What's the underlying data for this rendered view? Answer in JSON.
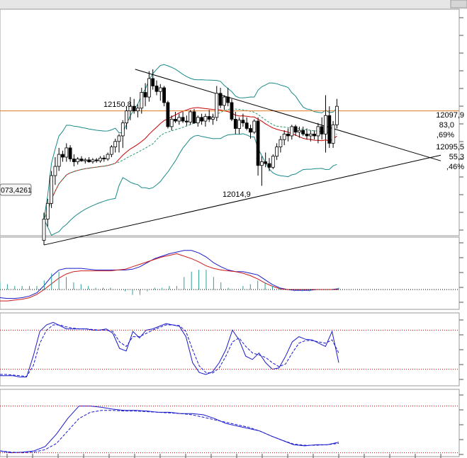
{
  "colors": {
    "background": "#ffffff",
    "frame": "#9a9a9a",
    "bollinger": "#1a8a8a",
    "ma_red": "#cc0000",
    "ma_dashed": "#2a9a6a",
    "horizontal_level": "#e07820",
    "osc_blue": "#1a1acc",
    "osc_red": "#cc1a1a",
    "histogram": "#2aa09a",
    "dotted_ref": "#cc0000"
  },
  "labels": {
    "high_label": "12150,8",
    "low_label": "12014,9",
    "left_price_box": "073,4261",
    "right_1": "12097,9",
    "right_2": "83,0",
    "right_3": ",69%",
    "right_4": "12095,5",
    "right_5": "55,3",
    "right_6": ",46%"
  },
  "chart_data": [
    {
      "type": "candlestick",
      "panel": "price",
      "title": "",
      "xlabel": "",
      "ylabel": "",
      "ylim": [
        11960,
        12205
      ],
      "horizontal_level": 12095,
      "annotations": [
        {
          "text": "12150,8",
          "kind": "swing-high"
        },
        {
          "text": "12014,9",
          "kind": "swing-low"
        },
        {
          "text": "073,4261",
          "kind": "left-price-box"
        },
        {
          "text": "12097,9"
        },
        {
          "text": "83,0"
        },
        {
          "text": ",69%"
        },
        {
          "text": "12095,5"
        },
        {
          "text": "55,3"
        },
        {
          "text": ",46%"
        }
      ],
      "candles": [
        [
          11955,
          11985,
          11950,
          11978
        ],
        [
          11978,
          12000,
          11970,
          11995
        ],
        [
          11995,
          12030,
          11990,
          12025
        ],
        [
          12025,
          12045,
          12015,
          12035
        ],
        [
          12035,
          12055,
          12030,
          12048
        ],
        [
          12048,
          12052,
          12040,
          12045
        ],
        [
          12045,
          12060,
          12040,
          12055
        ],
        [
          12055,
          12058,
          12040,
          12043
        ],
        [
          12043,
          12048,
          12035,
          12040
        ],
        [
          12040,
          12045,
          12037,
          12043
        ],
        [
          12043,
          12046,
          12040,
          12041
        ],
        [
          12041,
          12044,
          12038,
          12042
        ],
        [
          12042,
          12045,
          12039,
          12040
        ],
        [
          12040,
          12044,
          12038,
          12042
        ],
        [
          12042,
          12044,
          12039,
          12041
        ],
        [
          12041,
          12046,
          12039,
          12044
        ],
        [
          12044,
          12047,
          12040,
          12043
        ],
        [
          12043,
          12050,
          12041,
          12048
        ],
        [
          12048,
          12058,
          12045,
          12056
        ],
        [
          12056,
          12065,
          12050,
          12062
        ],
        [
          12062,
          12070,
          12050,
          12068
        ],
        [
          12068,
          12085,
          12055,
          12082
        ],
        [
          12082,
          12100,
          12075,
          12095
        ],
        [
          12095,
          12110,
          12085,
          12100
        ],
        [
          12100,
          12108,
          12092,
          12095
        ],
        [
          12095,
          12102,
          12088,
          12098
        ],
        [
          12098,
          12120,
          12092,
          12115
        ],
        [
          12115,
          12125,
          12100,
          12110
        ],
        [
          12110,
          12138,
          12105,
          12130
        ],
        [
          12130,
          12140,
          12118,
          12122
        ],
        [
          12122,
          12128,
          12112,
          12116
        ],
        [
          12116,
          12124,
          12106,
          12120
        ],
        [
          12120,
          12122,
          12100,
          12104
        ],
        [
          12104,
          12106,
          12076,
          12078
        ],
        [
          12078,
          12090,
          12074,
          12086
        ],
        [
          12086,
          12094,
          12082,
          12084
        ],
        [
          12084,
          12092,
          12080,
          12088
        ],
        [
          12088,
          12094,
          12082,
          12084
        ],
        [
          12084,
          12090,
          12079,
          12083
        ],
        [
          12083,
          12096,
          12080,
          12094
        ],
        [
          12094,
          12097,
          12081,
          12082
        ],
        [
          12082,
          12090,
          12078,
          12088
        ],
        [
          12088,
          12092,
          12080,
          12084
        ],
        [
          12084,
          12092,
          12078,
          12089
        ],
        [
          12089,
          12096,
          12083,
          12086
        ],
        [
          12086,
          12092,
          12080,
          12088
        ],
        [
          12088,
          12122,
          12084,
          12114
        ],
        [
          12114,
          12120,
          12098,
          12101
        ],
        [
          12101,
          12112,
          12096,
          12110
        ],
        [
          12110,
          12120,
          12100,
          12104
        ],
        [
          12104,
          12108,
          12084,
          12086
        ],
        [
          12086,
          12094,
          12070,
          12076
        ],
        [
          12076,
          12088,
          12070,
          12085
        ],
        [
          12085,
          12092,
          12078,
          12082
        ],
        [
          12082,
          12088,
          12074,
          12076
        ],
        [
          12076,
          12080,
          12065,
          12072
        ],
        [
          12072,
          12086,
          12070,
          12084
        ],
        [
          12084,
          12088,
          12025,
          12036
        ],
        [
          12036,
          12046,
          12014,
          12040
        ],
        [
          12040,
          12050,
          12034,
          12038
        ],
        [
          12038,
          12044,
          12030,
          12034
        ],
        [
          12034,
          12048,
          12032,
          12046
        ],
        [
          12046,
          12060,
          12042,
          12056
        ],
        [
          12056,
          12068,
          12050,
          12064
        ],
        [
          12064,
          12074,
          12058,
          12070
        ],
        [
          12070,
          12076,
          12062,
          12068
        ],
        [
          12068,
          12080,
          12064,
          12078
        ],
        [
          12078,
          12080,
          12068,
          12072
        ],
        [
          12072,
          12078,
          12066,
          12074
        ],
        [
          12074,
          12078,
          12068,
          12070
        ],
        [
          12070,
          12076,
          12064,
          12068
        ],
        [
          12068,
          12074,
          12062,
          12070
        ],
        [
          12070,
          12074,
          12064,
          12068
        ],
        [
          12068,
          12082,
          12060,
          12078
        ],
        [
          12078,
          12088,
          12064,
          12070
        ],
        [
          12070,
          12112,
          12050,
          12090
        ],
        [
          12090,
          12100,
          12055,
          12060
        ],
        [
          12060,
          12084,
          12055,
          12080
        ],
        [
          12080,
          12108,
          12076,
          12100
        ]
      ]
    },
    {
      "type": "line",
      "panel": "macd",
      "title": "",
      "series": [
        {
          "values": [
            -10,
            -11,
            -11,
            -10,
            -8,
            -4,
            5,
            16,
            24,
            26,
            26,
            26,
            25,
            24,
            24,
            24,
            24,
            24,
            25,
            28,
            33,
            38,
            41,
            44,
            46,
            48,
            48,
            45,
            40,
            33,
            28,
            24,
            22,
            22,
            20,
            18,
            12,
            6,
            2,
            0,
            -1,
            -1,
            -1,
            0,
            0,
            0,
            1
          ]
        },
        {
          "values": [
            -14,
            -14,
            -13,
            -12,
            -10,
            -6,
            0,
            7,
            14,
            19,
            22,
            23,
            23,
            23,
            23,
            23,
            24,
            25,
            28,
            31,
            34,
            37,
            40,
            42,
            44,
            41,
            38,
            34,
            29,
            26,
            24,
            23,
            22,
            20,
            17,
            13,
            8,
            4,
            1,
            0,
            0,
            0,
            0,
            0,
            0,
            0,
            0
          ]
        }
      ]
    },
    {
      "type": "line",
      "panel": "stochastic-1",
      "title": "",
      "series": [
        {
          "values": [
            10,
            10,
            10,
            8,
            8,
            40,
            78,
            88,
            92,
            87,
            82,
            82,
            82,
            82,
            80,
            80,
            82,
            75,
            52,
            48,
            78,
            68,
            80,
            82,
            86,
            90,
            88,
            86,
            70,
            30,
            15,
            12,
            16,
            30,
            50,
            80,
            65,
            40,
            35,
            45,
            30,
            20,
            22,
            40,
            62,
            70,
            66,
            65,
            60,
            55,
            78,
            30
          ]
        },
        {
          "values": [
            12,
            12,
            11,
            10,
            9,
            25,
            60,
            80,
            88,
            88,
            85,
            83,
            82,
            82,
            81,
            80,
            80,
            78,
            62,
            55,
            70,
            70,
            75,
            80,
            84,
            88,
            88,
            87,
            78,
            50,
            25,
            15,
            14,
            22,
            40,
            62,
            68,
            55,
            45,
            42,
            38,
            30,
            24,
            28,
            45,
            60,
            64,
            64,
            62,
            60,
            65,
            45
          ]
        }
      ]
    },
    {
      "type": "line",
      "panel": "stochastic-2",
      "title": "",
      "series": [
        {
          "values": [
            8,
            5,
            6,
            8,
            15,
            35,
            60,
            80,
            80,
            78,
            75,
            73,
            73,
            72,
            70,
            70,
            68,
            68,
            66,
            60,
            52,
            48,
            44,
            40,
            32,
            25,
            18,
            16,
            18,
            18,
            22
          ]
        },
        {
          "values": [
            8,
            6,
            5,
            6,
            10,
            20,
            40,
            60,
            70,
            73,
            73,
            72,
            72,
            71,
            70,
            69,
            68,
            66,
            62,
            58,
            54,
            50,
            46,
            40,
            32,
            25,
            19,
            17,
            17,
            18,
            20
          ]
        }
      ]
    }
  ]
}
